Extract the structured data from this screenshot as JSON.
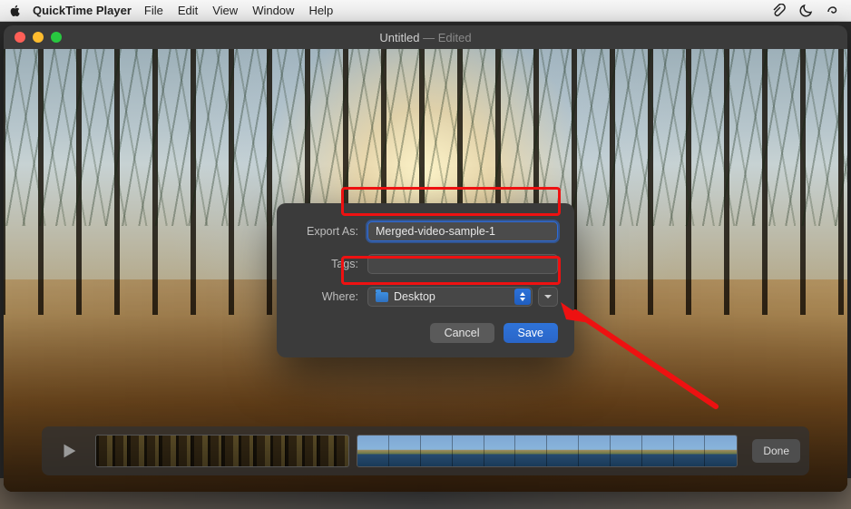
{
  "menubar": {
    "app_name": "QuickTime Player",
    "items": [
      "File",
      "Edit",
      "View",
      "Window",
      "Help"
    ]
  },
  "window": {
    "title": "Untitled",
    "title_suffix": " — Edited"
  },
  "dialog": {
    "export_as_label": "Export As:",
    "export_as_value": "Merged-video-sample-1",
    "tags_label": "Tags:",
    "tags_value": "",
    "where_label": "Where:",
    "where_value": "Desktop",
    "cancel_label": "Cancel",
    "save_label": "Save"
  },
  "controls": {
    "done_label": "Done"
  }
}
